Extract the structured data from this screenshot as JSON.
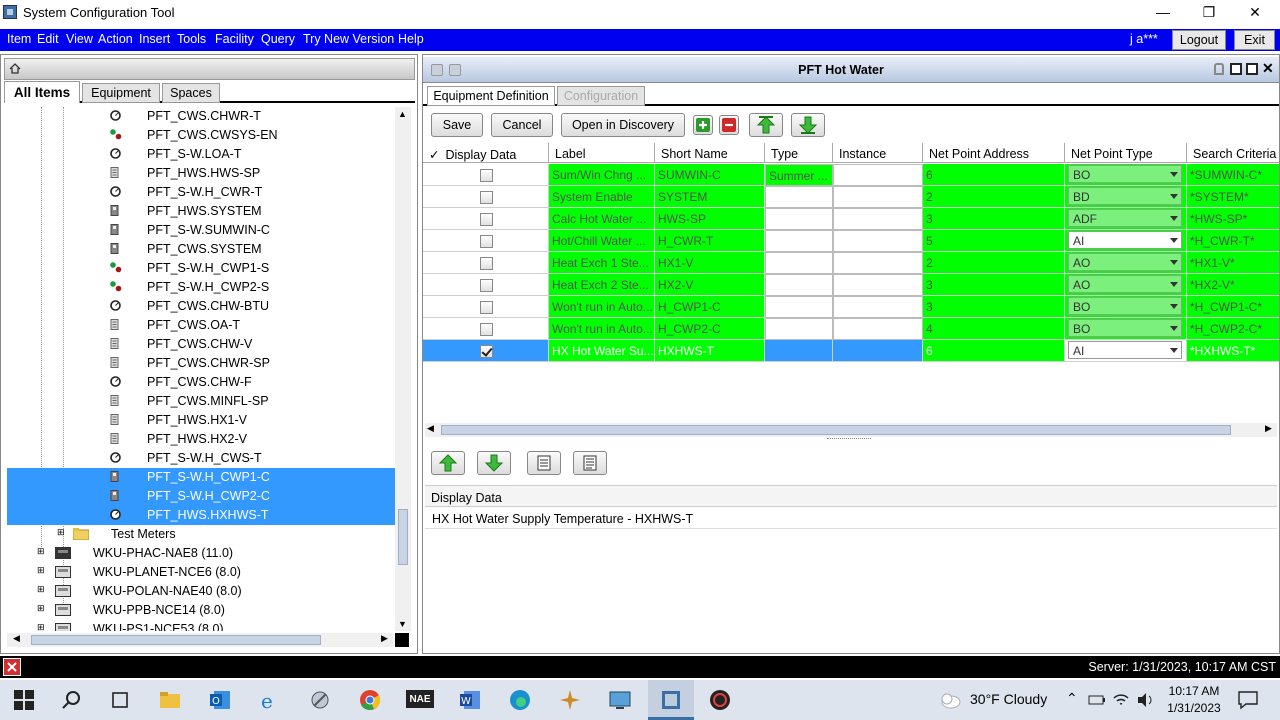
{
  "window": {
    "title": "System Configuration Tool"
  },
  "menu": {
    "items": [
      "Item",
      "Edit",
      "View",
      "Action",
      "Insert",
      "Tools",
      "Facility",
      "Query",
      "Try New Version",
      "Help"
    ],
    "user": "j a***",
    "logout": "Logout",
    "exit": "Exit"
  },
  "left": {
    "tabs": [
      "All Items",
      "Equipment",
      "Spaces"
    ],
    "tree": [
      {
        "label": "PFT_CWS.CHWR-T",
        "icon": "analog-point-icon",
        "sel": false
      },
      {
        "label": "PFT_CWS.CWSYS-EN",
        "icon": "binary-point-icon",
        "sel": false
      },
      {
        "label": "PFT_S-W.LOA-T",
        "icon": "analog-point-icon",
        "sel": false
      },
      {
        "label": "PFT_HWS.HWS-SP",
        "icon": "setpoint-icon",
        "sel": false
      },
      {
        "label": "PFT_S-W.H_CWR-T",
        "icon": "analog-point-icon",
        "sel": false
      },
      {
        "label": "PFT_HWS.SYSTEM",
        "icon": "multistate-icon",
        "sel": false
      },
      {
        "label": "PFT_S-W.SUMWIN-C",
        "icon": "multistate-icon",
        "sel": false
      },
      {
        "label": "PFT_CWS.SYSTEM",
        "icon": "multistate-icon",
        "sel": false
      },
      {
        "label": "PFT_S-W.H_CWP1-S",
        "icon": "binary-point-icon",
        "sel": false
      },
      {
        "label": "PFT_S-W.H_CWP2-S",
        "icon": "binary-point-icon",
        "sel": false
      },
      {
        "label": "PFT_CWS.CHW-BTU",
        "icon": "analog-point-icon",
        "sel": false
      },
      {
        "label": "PFT_CWS.OA-T",
        "icon": "setpoint-icon",
        "sel": false
      },
      {
        "label": "PFT_CWS.CHW-V",
        "icon": "setpoint-icon",
        "sel": false
      },
      {
        "label": "PFT_CWS.CHWR-SP",
        "icon": "setpoint-icon",
        "sel": false
      },
      {
        "label": "PFT_CWS.CHW-F",
        "icon": "analog-point-icon",
        "sel": false
      },
      {
        "label": "PFT_CWS.MINFL-SP",
        "icon": "setpoint-icon",
        "sel": false
      },
      {
        "label": "PFT_HWS.HX1-V",
        "icon": "setpoint-icon",
        "sel": false
      },
      {
        "label": "PFT_HWS.HX2-V",
        "icon": "setpoint-icon",
        "sel": false
      },
      {
        "label": "PFT_S-W.H_CWS-T",
        "icon": "analog-point-icon",
        "sel": false
      },
      {
        "label": "PFT_S-W.H_CWP1-C",
        "icon": "multistate-icon",
        "sel": true
      },
      {
        "label": "PFT_S-W.H_CWP2-C",
        "icon": "multistate-icon",
        "sel": true
      },
      {
        "label": "PFT_HWS.HXHWS-T",
        "icon": "analog-point-icon",
        "sel": true
      }
    ],
    "folder": "Test Meters",
    "devices": [
      "WKU-PHAC-NAE8 (11.0)",
      "WKU-PLANET-NCE6 (8.0)",
      "WKU-POLAN-NAE40 (8.0)",
      "WKU-PPB-NCE14 (8.0)",
      "WKU-PS1-NCE53 (8.0)"
    ]
  },
  "right": {
    "title": "PFT Hot Water",
    "tabs": [
      "Equipment Definition",
      "Configuration"
    ],
    "buttons": {
      "save": "Save",
      "cancel": "Cancel",
      "discovery": "Open in Discovery"
    },
    "columns": [
      "Display Data",
      "Label",
      "Short Name",
      "Type",
      "Instance",
      "Net Point Address",
      "Net Point Type",
      "Search Criteria"
    ],
    "check_header": "✓",
    "rows": [
      {
        "checked": false,
        "label": "Sum/Win Chng ...",
        "short": "SUMWIN-C",
        "type": "Summer ...",
        "instance": "",
        "addr": "6",
        "nptype": "BO",
        "search": "*SUMWIN-C*",
        "npgreen": true,
        "typegreen": true,
        "sel": false
      },
      {
        "checked": false,
        "label": "System Enable",
        "short": "SYSTEM",
        "type": "",
        "instance": "",
        "addr": "2",
        "nptype": "BD",
        "search": "*SYSTEM*",
        "npgreen": true,
        "typegreen": false,
        "sel": false
      },
      {
        "checked": false,
        "label": "Calc Hot Water ...",
        "short": "HWS-SP",
        "type": "",
        "instance": "",
        "addr": "3",
        "nptype": "ADF",
        "search": "*HWS-SP*",
        "npgreen": true,
        "typegreen": false,
        "sel": false
      },
      {
        "checked": false,
        "label": "Hot/Chill Water ...",
        "short": "H_CWR-T",
        "type": "",
        "instance": "",
        "addr": "5",
        "nptype": "AI",
        "search": "*H_CWR-T*",
        "npgreen": false,
        "typegreen": false,
        "sel": false
      },
      {
        "checked": false,
        "label": "Heat Exch 1 Ste...",
        "short": "HX1-V",
        "type": "",
        "instance": "",
        "addr": "2",
        "nptype": "AO",
        "search": "*HX1-V*",
        "npgreen": true,
        "typegreen": false,
        "sel": false
      },
      {
        "checked": false,
        "label": "Heat Exch 2 Ste...",
        "short": "HX2-V",
        "type": "",
        "instance": "",
        "addr": "3",
        "nptype": "AO",
        "search": "*HX2-V*",
        "npgreen": true,
        "typegreen": false,
        "sel": false
      },
      {
        "checked": false,
        "label": "Won't run in Auto...",
        "short": "H_CWP1-C",
        "type": "",
        "instance": "",
        "addr": "3",
        "nptype": "BO",
        "search": "*H_CWP1-C*",
        "npgreen": true,
        "typegreen": false,
        "sel": false
      },
      {
        "checked": false,
        "label": "Won't run in Auto...",
        "short": "H_CWP2-C",
        "type": "",
        "instance": "",
        "addr": "4",
        "nptype": "BO",
        "search": "*H_CWP2-C*",
        "npgreen": true,
        "typegreen": false,
        "sel": false
      },
      {
        "checked": true,
        "label": "HX Hot Water Su...",
        "short": "HXHWS-T",
        "type": "",
        "instance": "",
        "addr": "6",
        "nptype": "AI",
        "search": "*HXHWS-T*",
        "npgreen": false,
        "typegreen": false,
        "sel": true
      }
    ],
    "detail_header": "Display Data",
    "detail_value": "HX Hot Water Supply Temperature - HXHWS-T"
  },
  "status": {
    "server": "Server: 1/31/2023, 10:17 AM CST"
  },
  "taskbar": {
    "weather": "30°F  Cloudy",
    "time": "10:17 AM",
    "date": "1/31/2023",
    "nae": "NAE"
  }
}
